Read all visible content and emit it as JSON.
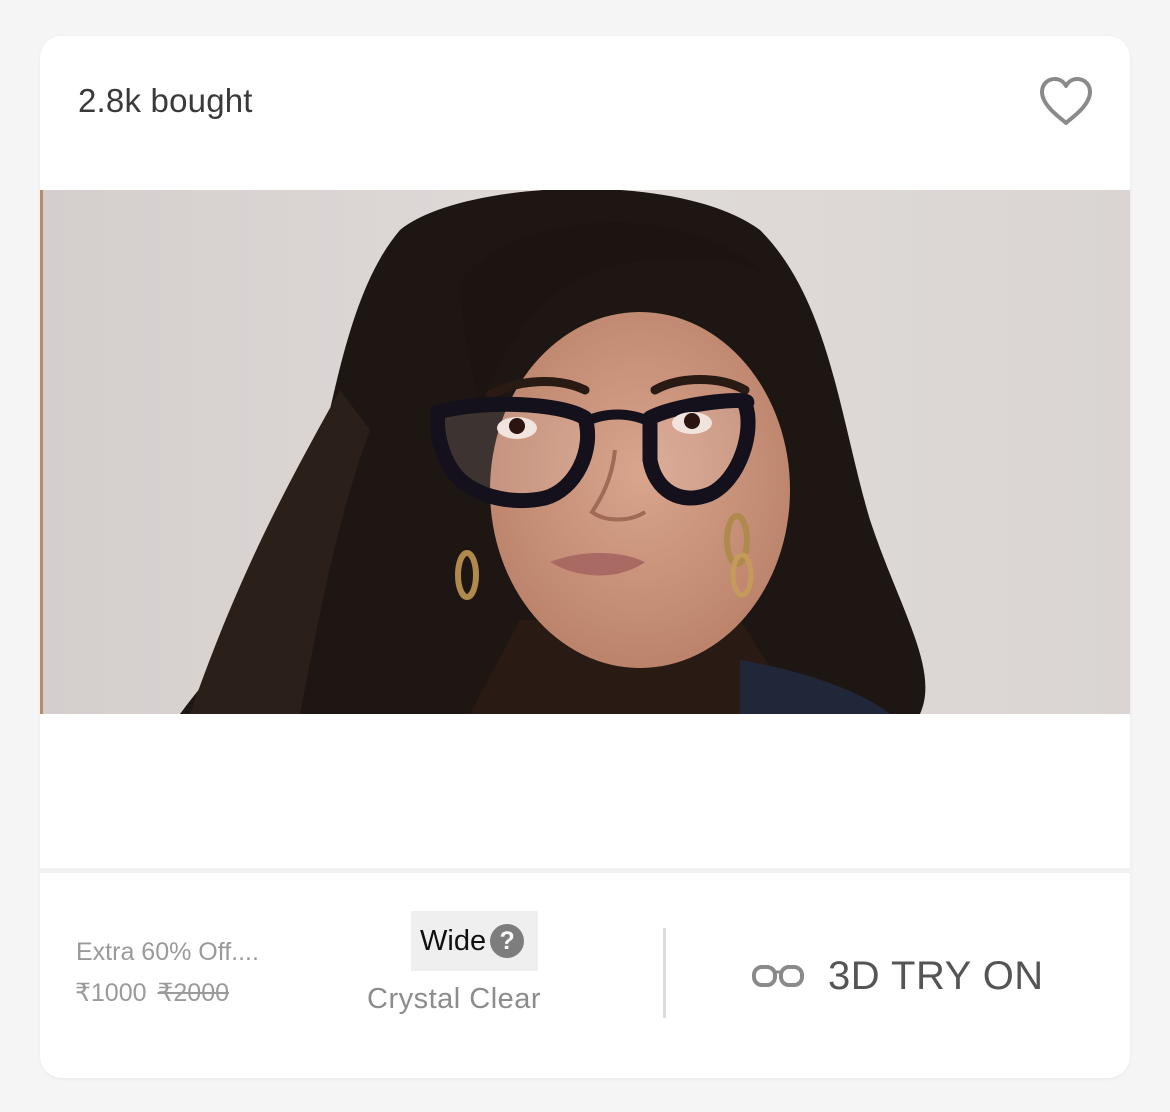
{
  "card": {
    "bought_text": "2.8k bought",
    "favorite_icon": "heart-outline-icon",
    "product_image_alt": "Model wearing black cat-eye eyeglasses",
    "offer_text": "Extra 60% Off....",
    "price_current": "₹1000",
    "price_original": "₹2000",
    "frame_width": "Wide",
    "help_glyph": "?",
    "color_name": "Crystal Clear",
    "tryon_icon": "glasses-icon",
    "tryon_label": "3D TRY ON"
  },
  "colors": {
    "card_bg": "#ffffff",
    "page_bg": "#f5f5f5",
    "muted_text": "#9a9a9a",
    "tryon_text": "#555555"
  }
}
